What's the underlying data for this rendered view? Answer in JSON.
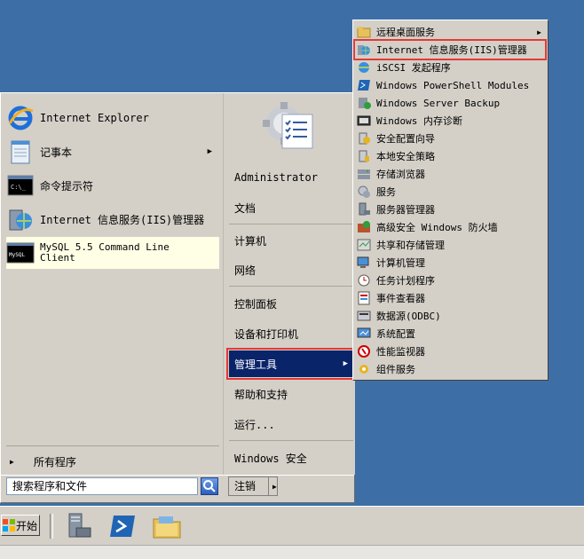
{
  "start_menu": {
    "programs": [
      {
        "label": "Internet Explorer",
        "icon": "internet-explorer-icon"
      },
      {
        "label": "记事本",
        "icon": "notepad-icon",
        "has_submenu": true
      },
      {
        "label": "命令提示符",
        "icon": "command-prompt-icon"
      },
      {
        "label": "Internet 信息服务(IIS)管理器",
        "icon": "iis-manager-icon"
      },
      {
        "label": "MySQL 5.5 Command Line Client",
        "icon": "mysql-console-icon"
      }
    ],
    "all_programs": "所有程序",
    "search_placeholder": "搜索程序和文件",
    "right_items": {
      "user": "Administrator",
      "documents": "文档",
      "computer": "计算机",
      "network": "网络",
      "control_panel": "控制面板",
      "devices_printers": "设备和打印机",
      "admin_tools": "管理工具",
      "help": "帮助和支持",
      "run": "运行...",
      "security": "Windows 安全"
    },
    "logoff": "注销"
  },
  "admin_tools_submenu": [
    {
      "label": "远程桌面服务",
      "icon": "folder-icon",
      "has_submenu": true
    },
    {
      "label": "Internet 信息服务(IIS)管理器",
      "icon": "iis-manager-icon",
      "highlighted": true
    },
    {
      "label": "iSCSI 发起程序",
      "icon": "iscsi-icon"
    },
    {
      "label": "Windows PowerShell Modules",
      "icon": "powershell-icon"
    },
    {
      "label": "Windows Server Backup",
      "icon": "backup-icon"
    },
    {
      "label": "Windows 内存诊断",
      "icon": "memory-diagnostic-icon"
    },
    {
      "label": "安全配置向导",
      "icon": "security-wizard-icon"
    },
    {
      "label": "本地安全策略",
      "icon": "local-policy-icon"
    },
    {
      "label": "存储浏览器",
      "icon": "storage-explorer-icon"
    },
    {
      "label": "服务",
      "icon": "services-icon"
    },
    {
      "label": "服务器管理器",
      "icon": "server-manager-icon"
    },
    {
      "label": "高级安全 Windows 防火墙",
      "icon": "firewall-icon"
    },
    {
      "label": "共享和存储管理",
      "icon": "share-storage-icon"
    },
    {
      "label": "计算机管理",
      "icon": "computer-management-icon"
    },
    {
      "label": "任务计划程序",
      "icon": "task-scheduler-icon"
    },
    {
      "label": "事件查看器",
      "icon": "event-viewer-icon"
    },
    {
      "label": "数据源(ODBC)",
      "icon": "odbc-icon"
    },
    {
      "label": "系统配置",
      "icon": "system-config-icon"
    },
    {
      "label": "性能监视器",
      "icon": "performance-monitor-icon"
    },
    {
      "label": "组件服务",
      "icon": "component-services-icon"
    }
  ],
  "taskbar": {
    "start_label": "开始",
    "pinned": [
      "server-manager-icon",
      "powershell-icon",
      "explorer-folder-icon"
    ]
  },
  "colors": {
    "desktop": "#3d6fa6",
    "menu_bg": "#d4d0c8",
    "selection": "#0a246a",
    "annotation_red": "#e53935"
  }
}
